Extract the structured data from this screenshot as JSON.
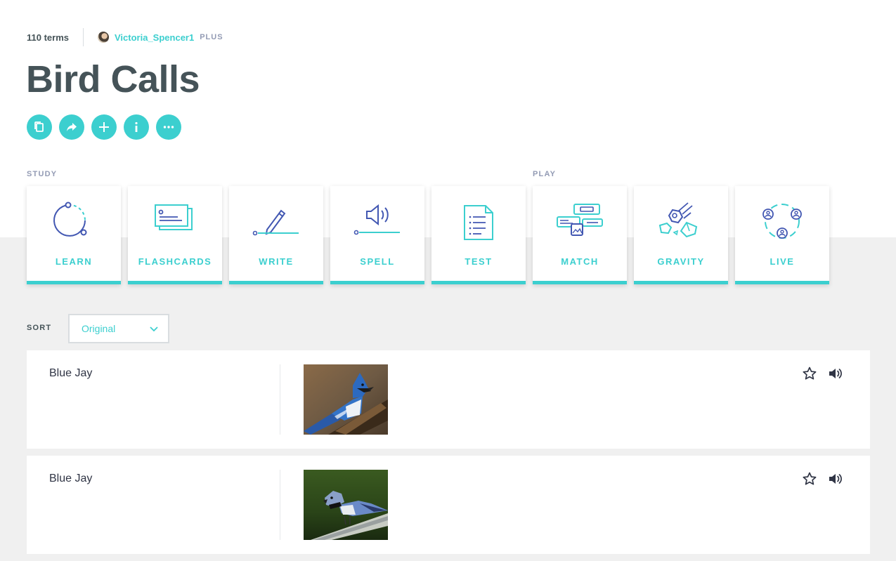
{
  "header": {
    "terms_count": "110 terms",
    "username": "Victoria_Spencer1",
    "badge": "PLUS",
    "title": "Bird Calls"
  },
  "actions": [
    {
      "name": "copy-icon",
      "label": "Copy"
    },
    {
      "name": "share-icon",
      "label": "Share"
    },
    {
      "name": "add-icon",
      "label": "Add"
    },
    {
      "name": "info-icon",
      "label": "Info"
    },
    {
      "name": "more-icon",
      "label": "More"
    }
  ],
  "study": {
    "section_label": "STUDY",
    "modes": [
      "LEARN",
      "FLASHCARDS",
      "WRITE",
      "SPELL",
      "TEST"
    ]
  },
  "play": {
    "section_label": "PLAY",
    "modes": [
      "MATCH",
      "GRAVITY",
      "LIVE"
    ]
  },
  "sort": {
    "label": "SORT",
    "selected": "Original"
  },
  "terms": [
    {
      "word": "Blue Jay",
      "image": "blue-jay-on-branch"
    },
    {
      "word": "Blue Jay",
      "image": "blue-jay-on-feeder"
    }
  ],
  "colors": {
    "accent": "#3ccfcf",
    "icon_navy": "#4257b2",
    "title": "#455358",
    "background_gray": "#f0f0f0"
  }
}
